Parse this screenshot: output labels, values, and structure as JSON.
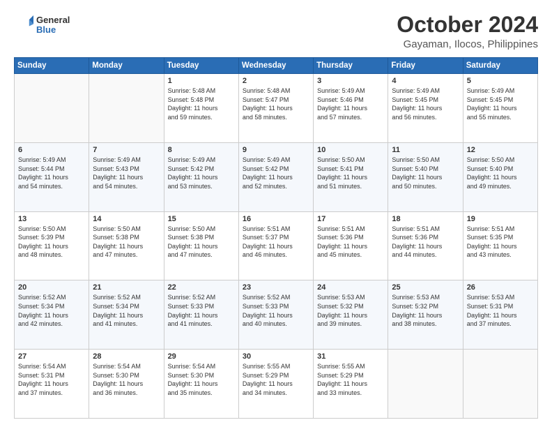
{
  "header": {
    "logo_general": "General",
    "logo_blue": "Blue",
    "title": "October 2024",
    "subtitle": "Gayaman, Ilocos, Philippines"
  },
  "days_of_week": [
    "Sunday",
    "Monday",
    "Tuesday",
    "Wednesday",
    "Thursday",
    "Friday",
    "Saturday"
  ],
  "weeks": [
    [
      {
        "day": "",
        "detail": ""
      },
      {
        "day": "",
        "detail": ""
      },
      {
        "day": "1",
        "detail": "Sunrise: 5:48 AM\nSunset: 5:48 PM\nDaylight: 11 hours\nand 59 minutes."
      },
      {
        "day": "2",
        "detail": "Sunrise: 5:48 AM\nSunset: 5:47 PM\nDaylight: 11 hours\nand 58 minutes."
      },
      {
        "day": "3",
        "detail": "Sunrise: 5:49 AM\nSunset: 5:46 PM\nDaylight: 11 hours\nand 57 minutes."
      },
      {
        "day": "4",
        "detail": "Sunrise: 5:49 AM\nSunset: 5:45 PM\nDaylight: 11 hours\nand 56 minutes."
      },
      {
        "day": "5",
        "detail": "Sunrise: 5:49 AM\nSunset: 5:45 PM\nDaylight: 11 hours\nand 55 minutes."
      }
    ],
    [
      {
        "day": "6",
        "detail": "Sunrise: 5:49 AM\nSunset: 5:44 PM\nDaylight: 11 hours\nand 54 minutes."
      },
      {
        "day": "7",
        "detail": "Sunrise: 5:49 AM\nSunset: 5:43 PM\nDaylight: 11 hours\nand 54 minutes."
      },
      {
        "day": "8",
        "detail": "Sunrise: 5:49 AM\nSunset: 5:42 PM\nDaylight: 11 hours\nand 53 minutes."
      },
      {
        "day": "9",
        "detail": "Sunrise: 5:49 AM\nSunset: 5:42 PM\nDaylight: 11 hours\nand 52 minutes."
      },
      {
        "day": "10",
        "detail": "Sunrise: 5:50 AM\nSunset: 5:41 PM\nDaylight: 11 hours\nand 51 minutes."
      },
      {
        "day": "11",
        "detail": "Sunrise: 5:50 AM\nSunset: 5:40 PM\nDaylight: 11 hours\nand 50 minutes."
      },
      {
        "day": "12",
        "detail": "Sunrise: 5:50 AM\nSunset: 5:40 PM\nDaylight: 11 hours\nand 49 minutes."
      }
    ],
    [
      {
        "day": "13",
        "detail": "Sunrise: 5:50 AM\nSunset: 5:39 PM\nDaylight: 11 hours\nand 48 minutes."
      },
      {
        "day": "14",
        "detail": "Sunrise: 5:50 AM\nSunset: 5:38 PM\nDaylight: 11 hours\nand 47 minutes."
      },
      {
        "day": "15",
        "detail": "Sunrise: 5:50 AM\nSunset: 5:38 PM\nDaylight: 11 hours\nand 47 minutes."
      },
      {
        "day": "16",
        "detail": "Sunrise: 5:51 AM\nSunset: 5:37 PM\nDaylight: 11 hours\nand 46 minutes."
      },
      {
        "day": "17",
        "detail": "Sunrise: 5:51 AM\nSunset: 5:36 PM\nDaylight: 11 hours\nand 45 minutes."
      },
      {
        "day": "18",
        "detail": "Sunrise: 5:51 AM\nSunset: 5:36 PM\nDaylight: 11 hours\nand 44 minutes."
      },
      {
        "day": "19",
        "detail": "Sunrise: 5:51 AM\nSunset: 5:35 PM\nDaylight: 11 hours\nand 43 minutes."
      }
    ],
    [
      {
        "day": "20",
        "detail": "Sunrise: 5:52 AM\nSunset: 5:34 PM\nDaylight: 11 hours\nand 42 minutes."
      },
      {
        "day": "21",
        "detail": "Sunrise: 5:52 AM\nSunset: 5:34 PM\nDaylight: 11 hours\nand 41 minutes."
      },
      {
        "day": "22",
        "detail": "Sunrise: 5:52 AM\nSunset: 5:33 PM\nDaylight: 11 hours\nand 41 minutes."
      },
      {
        "day": "23",
        "detail": "Sunrise: 5:52 AM\nSunset: 5:33 PM\nDaylight: 11 hours\nand 40 minutes."
      },
      {
        "day": "24",
        "detail": "Sunrise: 5:53 AM\nSunset: 5:32 PM\nDaylight: 11 hours\nand 39 minutes."
      },
      {
        "day": "25",
        "detail": "Sunrise: 5:53 AM\nSunset: 5:32 PM\nDaylight: 11 hours\nand 38 minutes."
      },
      {
        "day": "26",
        "detail": "Sunrise: 5:53 AM\nSunset: 5:31 PM\nDaylight: 11 hours\nand 37 minutes."
      }
    ],
    [
      {
        "day": "27",
        "detail": "Sunrise: 5:54 AM\nSunset: 5:31 PM\nDaylight: 11 hours\nand 37 minutes."
      },
      {
        "day": "28",
        "detail": "Sunrise: 5:54 AM\nSunset: 5:30 PM\nDaylight: 11 hours\nand 36 minutes."
      },
      {
        "day": "29",
        "detail": "Sunrise: 5:54 AM\nSunset: 5:30 PM\nDaylight: 11 hours\nand 35 minutes."
      },
      {
        "day": "30",
        "detail": "Sunrise: 5:55 AM\nSunset: 5:29 PM\nDaylight: 11 hours\nand 34 minutes."
      },
      {
        "day": "31",
        "detail": "Sunrise: 5:55 AM\nSunset: 5:29 PM\nDaylight: 11 hours\nand 33 minutes."
      },
      {
        "day": "",
        "detail": ""
      },
      {
        "day": "",
        "detail": ""
      }
    ]
  ]
}
